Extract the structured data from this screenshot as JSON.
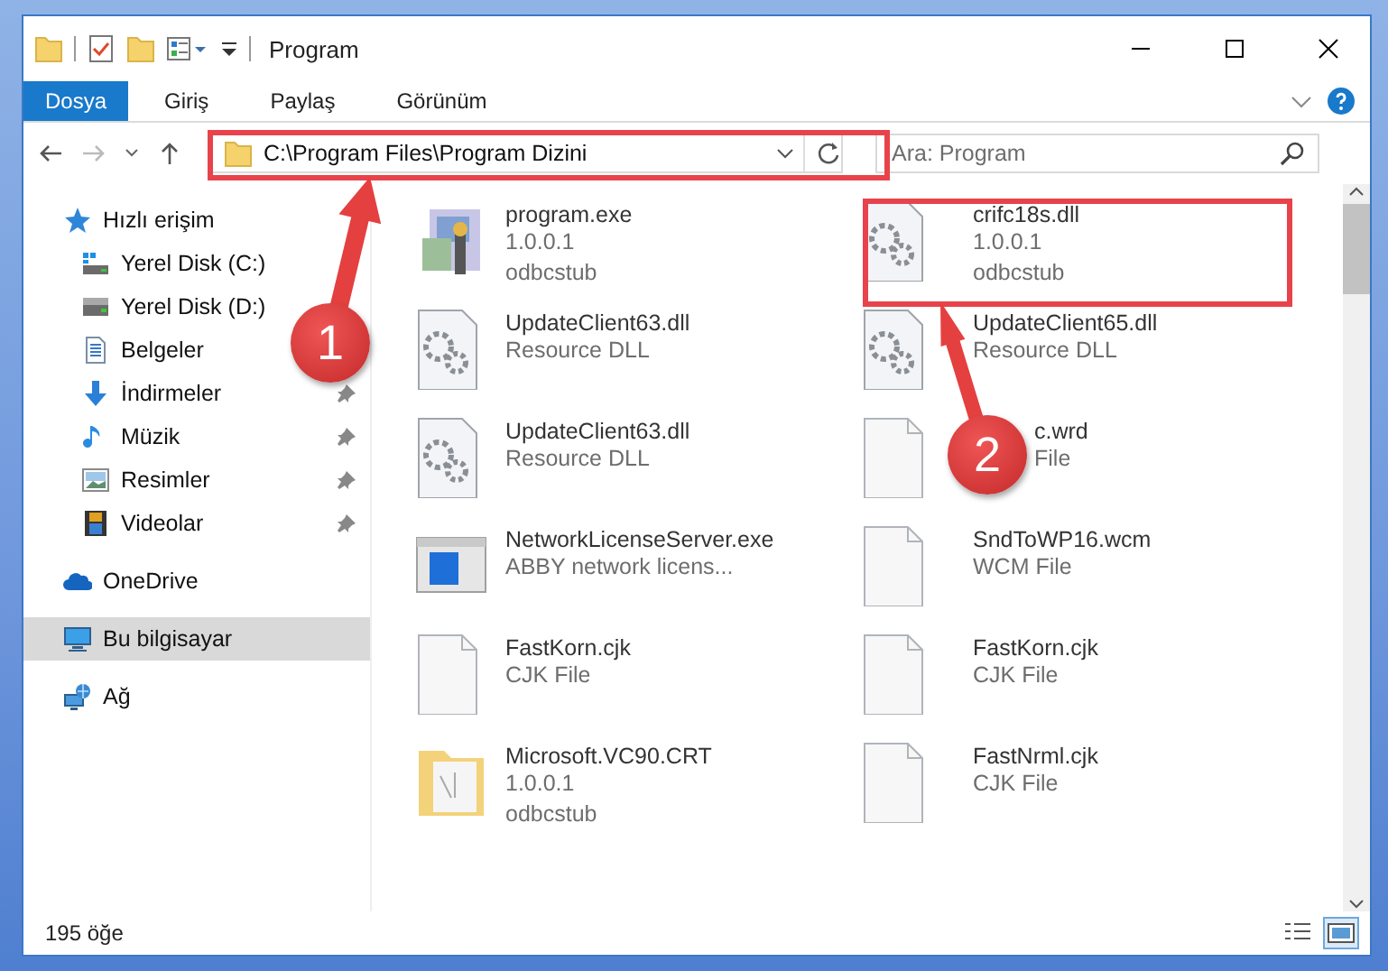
{
  "window": {
    "title": "Program"
  },
  "ribbon": {
    "tabs": [
      {
        "label": "Dosya",
        "selected": true
      },
      {
        "label": "Giriş",
        "selected": false
      },
      {
        "label": "Paylaş",
        "selected": false
      },
      {
        "label": "Görünüm",
        "selected": false
      }
    ]
  },
  "address": {
    "path": "C:\\Program Files\\Program Dizini",
    "search": {
      "placeholder": "Ara: Program"
    }
  },
  "sidebar": {
    "items": [
      {
        "label": "Hızlı erişim",
        "selected": false,
        "children": [
          {
            "label": "Yerel Disk (C:)",
            "pinned": false
          },
          {
            "label": "Yerel Disk (D:)",
            "pinned": false
          },
          {
            "label": "Belgeler",
            "pinned": false
          },
          {
            "label": "İndirmeler",
            "pinned": true
          },
          {
            "label": "Müzik",
            "pinned": true
          },
          {
            "label": "Resimler",
            "pinned": true
          },
          {
            "label": "Videolar",
            "pinned": true
          }
        ]
      },
      {
        "label": "OneDrive",
        "selected": false
      },
      {
        "label": "Bu bilgisayar",
        "selected": true
      },
      {
        "label": "Ağ",
        "selected": false
      }
    ]
  },
  "files": [
    {
      "name": "program.exe",
      "lines": [
        "1.0.0.1",
        "odbcstub"
      ],
      "kind": "installer"
    },
    {
      "name": "crifc18s.dll",
      "lines": [
        "1.0.0.1",
        "odbcstub"
      ],
      "kind": "library"
    },
    {
      "name": "UpdateClient63.dll",
      "lines": [
        "Resource DLL"
      ],
      "kind": "library"
    },
    {
      "name": "UpdateClient65.dll",
      "lines": [
        "Resource DLL"
      ],
      "kind": "library"
    },
    {
      "name": "UpdateClient63.dll",
      "lines": [
        "Resource DLL"
      ],
      "kind": "library"
    },
    {
      "name": "c.wrd",
      "lines": [
        "File"
      ],
      "kind": "blank"
    },
    {
      "name": "NetworkLicenseServer.exe",
      "lines": [
        "ABBY network licens..."
      ],
      "kind": "app"
    },
    {
      "name": "SndToWP16.wcm",
      "lines": [
        "WCM File"
      ],
      "kind": "blank"
    },
    {
      "name": "FastKorn.cjk",
      "lines": [
        "CJK File"
      ],
      "kind": "blank"
    },
    {
      "name": "FastKorn.cjk",
      "lines": [
        "CJK File"
      ],
      "kind": "blank"
    },
    {
      "name": "Microsoft.VC90.CRT",
      "lines": [
        "1.0.0.1",
        "odbcstub"
      ],
      "kind": "folder"
    },
    {
      "name": "FastNrml.cjk",
      "lines": [
        "CJK File"
      ],
      "kind": "blank"
    }
  ],
  "status_bar": {
    "count": "195 öğe",
    "views": [
      {
        "kind": "details",
        "selected": false
      },
      {
        "kind": "large",
        "selected": true
      }
    ]
  },
  "annotations": [
    {
      "label": "1"
    },
    {
      "label": "2"
    }
  ]
}
